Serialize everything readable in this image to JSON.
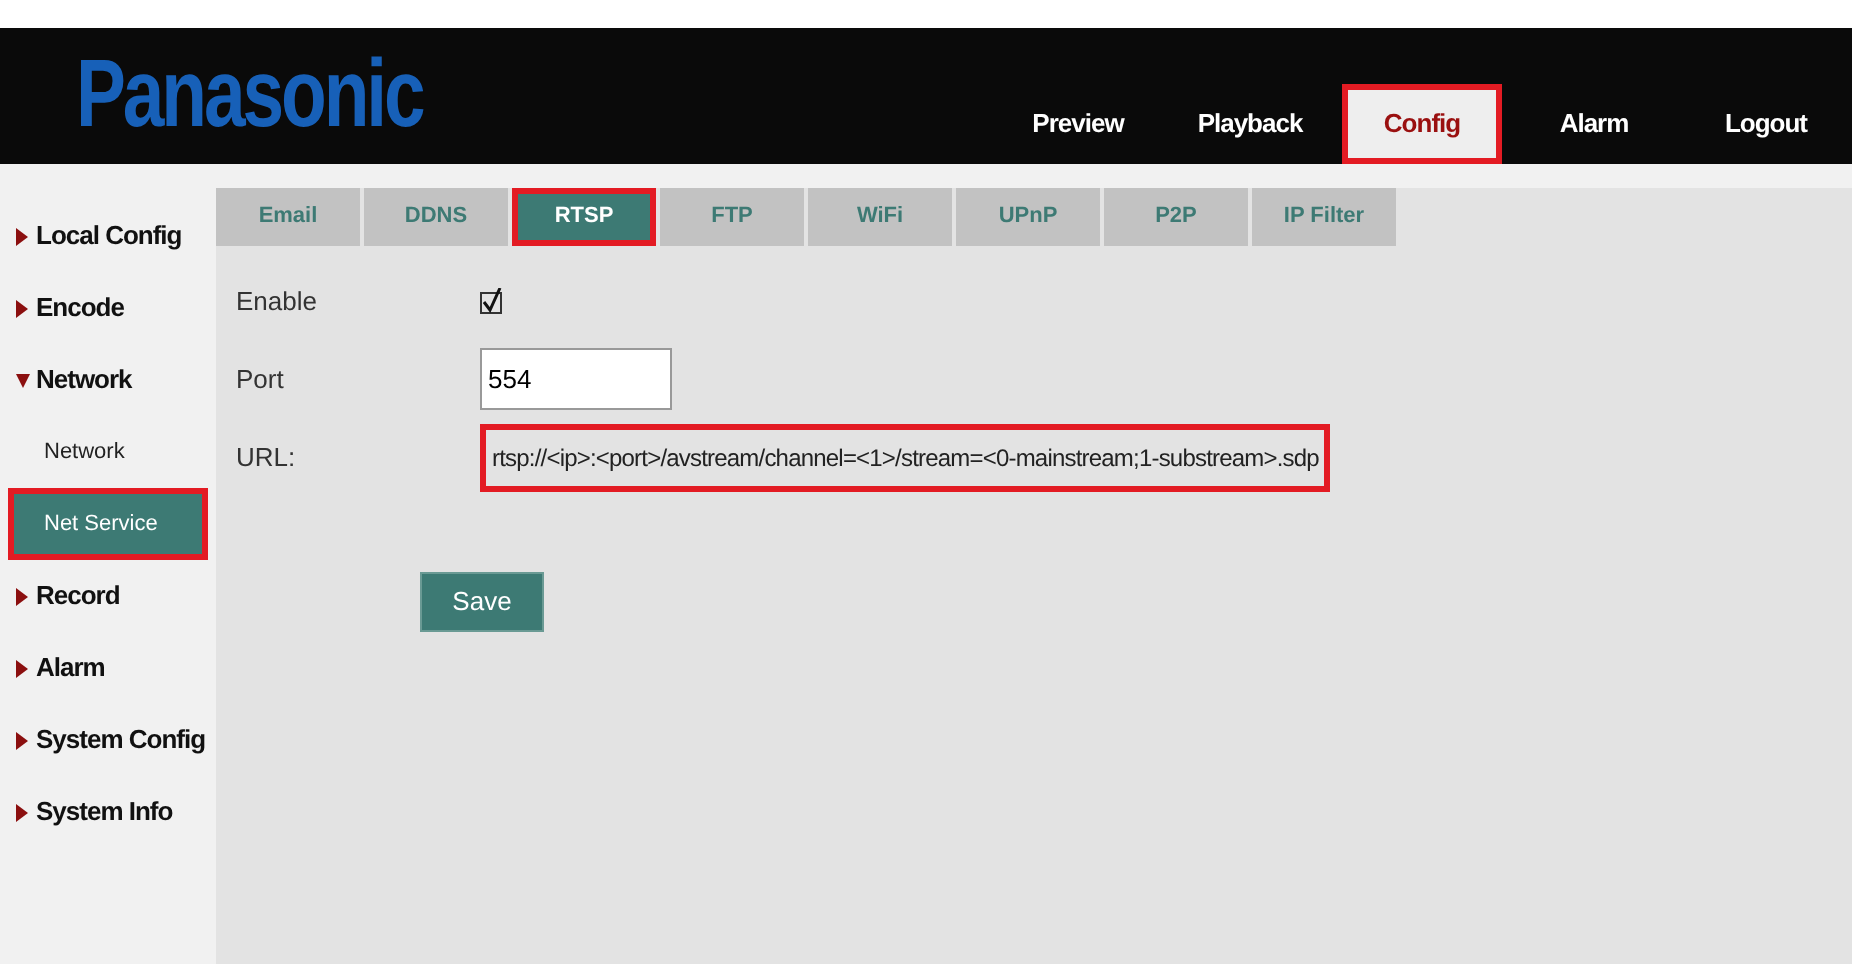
{
  "header": {
    "logo": "Panasonic",
    "nav": [
      {
        "label": "Preview",
        "selected": false,
        "highlighted": false
      },
      {
        "label": "Playback",
        "selected": false,
        "highlighted": false
      },
      {
        "label": "Config",
        "selected": true,
        "highlighted": true
      },
      {
        "label": "Alarm",
        "selected": false,
        "highlighted": false
      },
      {
        "label": "Logout",
        "selected": false,
        "highlighted": false
      }
    ]
  },
  "sidebar": {
    "items": [
      {
        "label": "Local Config",
        "expanded": false
      },
      {
        "label": "Encode",
        "expanded": false
      },
      {
        "label": "Network",
        "expanded": true,
        "children": [
          {
            "label": "Network",
            "selected": false,
            "highlighted": false
          },
          {
            "label": "Net Service",
            "selected": true,
            "highlighted": true
          }
        ]
      },
      {
        "label": "Record",
        "expanded": false
      },
      {
        "label": "Alarm",
        "expanded": false
      },
      {
        "label": "System Config",
        "expanded": false
      },
      {
        "label": "System Info",
        "expanded": false
      }
    ]
  },
  "tabs": [
    {
      "label": "Email",
      "selected": false,
      "highlighted": false
    },
    {
      "label": "DDNS",
      "selected": false,
      "highlighted": false
    },
    {
      "label": "RTSP",
      "selected": true,
      "highlighted": true
    },
    {
      "label": "FTP",
      "selected": false,
      "highlighted": false
    },
    {
      "label": "WiFi",
      "selected": false,
      "highlighted": false
    },
    {
      "label": "UPnP",
      "selected": false,
      "highlighted": false
    },
    {
      "label": "P2P",
      "selected": false,
      "highlighted": false
    },
    {
      "label": "IP Filter",
      "selected": false,
      "highlighted": false
    }
  ],
  "form": [
    {
      "kind": "checkbox",
      "label": "Enable",
      "checked": true
    },
    {
      "kind": "input",
      "label": "Port",
      "value": "554"
    },
    {
      "kind": "text",
      "label": "URL:",
      "value": "rtsp://<ip>:<port>/avstream/channel=<1>/stream=<0-mainstream;1-substream>.sdp",
      "highlighted": true
    }
  ],
  "save_button": "Save"
}
